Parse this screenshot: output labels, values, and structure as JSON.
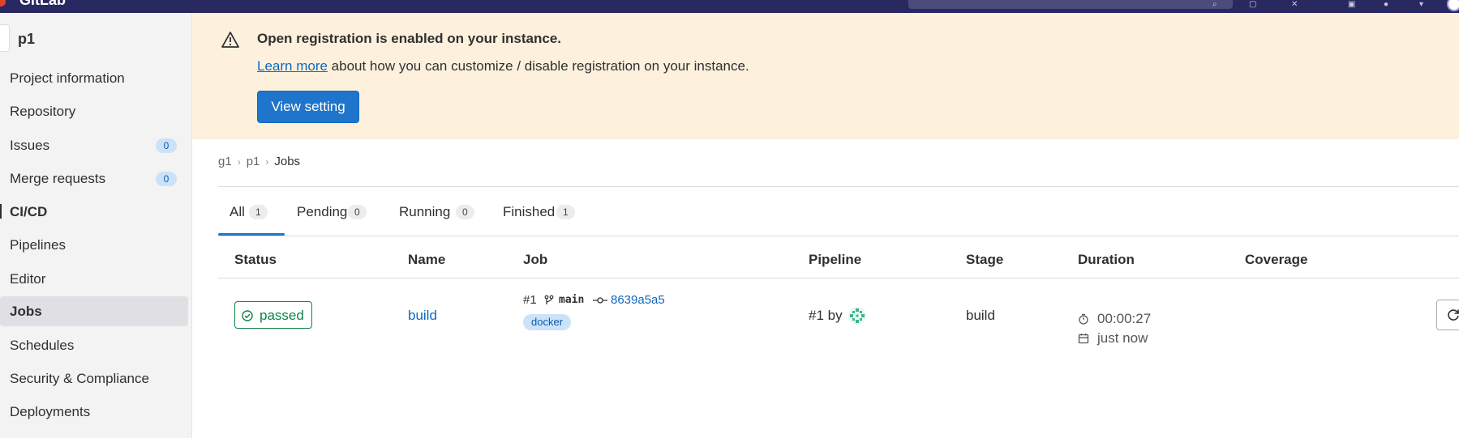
{
  "topbar": {
    "brand": "GitLab"
  },
  "sidebar": {
    "project_name": "p1",
    "items": [
      {
        "label": "Project information",
        "count": ""
      },
      {
        "label": "Repository",
        "count": ""
      },
      {
        "label": "Issues",
        "count": "0"
      },
      {
        "label": "Merge requests",
        "count": "0"
      },
      {
        "label": "CI/CD",
        "count": ""
      },
      {
        "label": "Pipelines",
        "count": ""
      },
      {
        "label": "Editor",
        "count": ""
      },
      {
        "label": "Jobs",
        "count": ""
      },
      {
        "label": "Schedules",
        "count": ""
      },
      {
        "label": "Security & Compliance",
        "count": ""
      },
      {
        "label": "Deployments",
        "count": ""
      }
    ],
    "active_item": "Jobs"
  },
  "banner": {
    "title": "Open registration is enabled on your instance.",
    "link_text": "Learn more",
    "text_after_link": " about how you can customize / disable registration on your instance.",
    "button_label": "View setting"
  },
  "breadcrumb": {
    "items": [
      "g1",
      "p1",
      "Jobs"
    ]
  },
  "tabs": [
    {
      "label": "All",
      "count": "1"
    },
    {
      "label": "Pending",
      "count": "0"
    },
    {
      "label": "Running",
      "count": "0"
    },
    {
      "label": "Finished",
      "count": "1"
    }
  ],
  "table": {
    "headers": [
      "Status",
      "Name",
      "Job",
      "Pipeline",
      "Stage",
      "Duration",
      "Coverage"
    ],
    "rows": [
      {
        "status": "passed",
        "name": "build",
        "job_id": "#1",
        "ref": "main",
        "sha": "8639a5a5",
        "tag": "docker",
        "pipeline": "#1 by",
        "stage": "build",
        "duration": "00:00:27",
        "finished": "just now",
        "coverage": ""
      }
    ]
  },
  "colors": {
    "banner_bg": "#fdf1dd",
    "primary": "#1f75cb",
    "success": "#108548",
    "topbar": "#292961"
  }
}
